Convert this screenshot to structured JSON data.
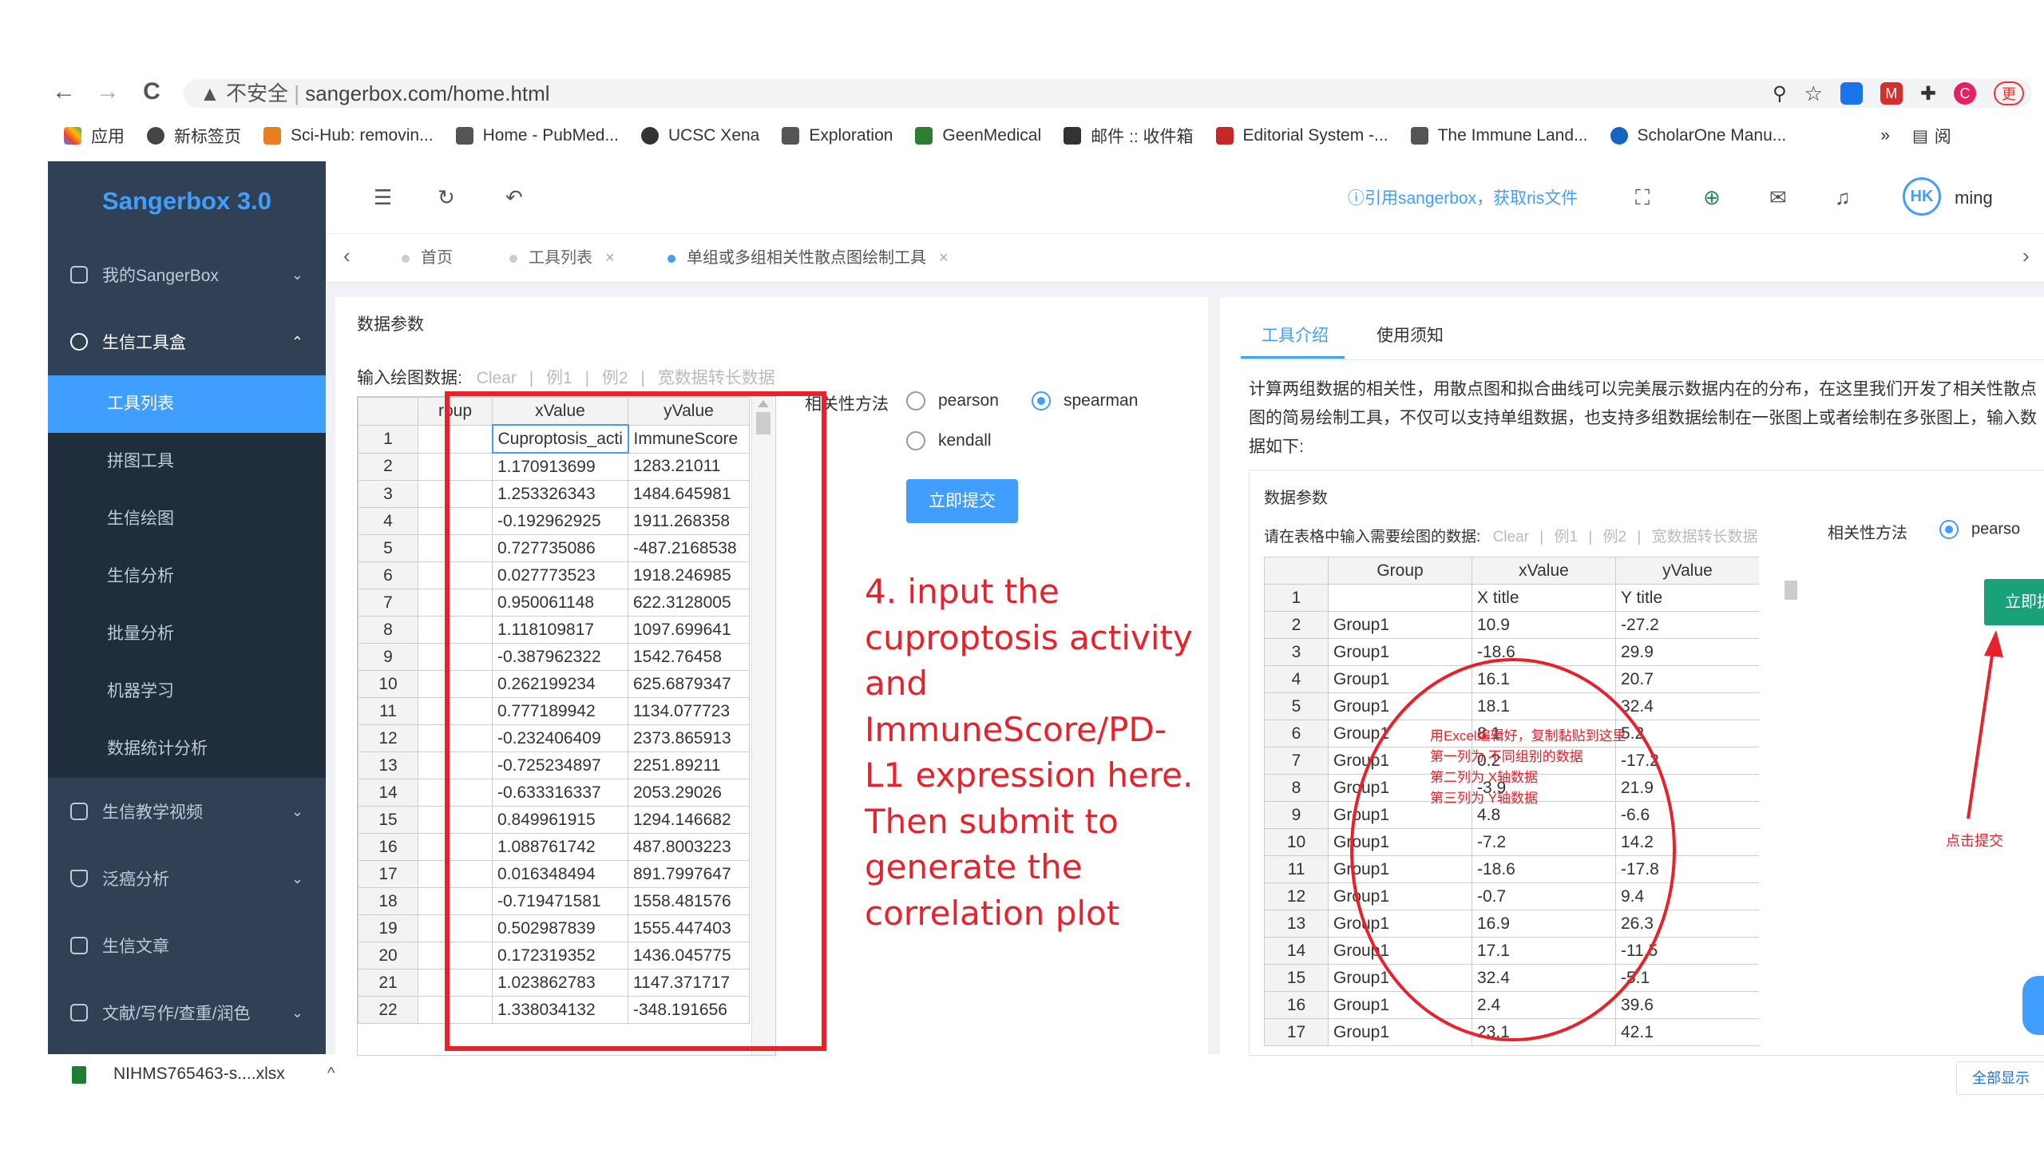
{
  "browser": {
    "nav": [
      "←",
      "→",
      "C"
    ],
    "security": "不安全",
    "url": "sangerbox.com/home.html",
    "bookmarks": [
      "应用",
      "新标签页",
      "Sci-Hub: removin...",
      "Home - PubMed...",
      "UCSC Xena",
      "Exploration",
      "GeenMedical",
      "邮件 :: 收件箱",
      "Editorial System -...",
      "The Immune Land...",
      "ScholarOne Manu..."
    ],
    "bookmarks_more": "»",
    "reading": "阅",
    "profile_label": "更"
  },
  "sidebar": {
    "logo": "Sangerbox 3.0",
    "menus": [
      {
        "label": "我的SangerBox",
        "arrow": "⌄"
      },
      {
        "label": "生信工具盒",
        "arrow": "⌃"
      }
    ],
    "submenu": [
      "工具列表",
      "拼图工具",
      "生信绘图",
      "生信分析",
      "批量分析",
      "机器学习",
      "数据统计分析"
    ],
    "menus2": [
      "生信教学视频",
      "泛癌分析",
      "生信文章",
      "文献/写作/查重/润色"
    ]
  },
  "header": {
    "cite": "ⓘ引用sangerbox，获取ris文件",
    "user": "ming"
  },
  "tags": [
    "首页",
    "工具列表",
    "单组或多组相关性散点图绘制工具"
  ],
  "left_panel": {
    "title": "数据参数",
    "input_label": "输入绘图数据:",
    "links": [
      "Clear",
      "例1",
      "例2",
      "宽数据转长数据"
    ],
    "separator": "|",
    "columns": [
      "roup",
      "xValue",
      "yValue"
    ],
    "rows": [
      [
        "1",
        "",
        "Cuproptosis_acti",
        "ImmuneScore"
      ],
      [
        "2",
        "",
        "1.170913699",
        "1283.21011"
      ],
      [
        "3",
        "",
        "1.253326343",
        "1484.645981"
      ],
      [
        "4",
        "",
        "-0.192962925",
        "1911.268358"
      ],
      [
        "5",
        "",
        "0.727735086",
        "-487.2168538"
      ],
      [
        "6",
        "",
        "0.027773523",
        "1918.246985"
      ],
      [
        "7",
        "",
        "0.950061148",
        "622.3128005"
      ],
      [
        "8",
        "",
        "1.118109817",
        "1097.699641"
      ],
      [
        "9",
        "",
        "-0.387962322",
        "1542.76458"
      ],
      [
        "10",
        "",
        "0.262199234",
        "625.6879347"
      ],
      [
        "11",
        "",
        "0.777189942",
        "1134.077723"
      ],
      [
        "12",
        "",
        "-0.232406409",
        "2373.865913"
      ],
      [
        "13",
        "",
        "-0.725234897",
        "2251.89211"
      ],
      [
        "14",
        "",
        "-0.633316337",
        "2053.29026"
      ],
      [
        "15",
        "",
        "0.849961915",
        "1294.146682"
      ],
      [
        "16",
        "",
        "1.088761742",
        "487.8003223"
      ],
      [
        "17",
        "",
        "0.016348494",
        "891.7997647"
      ],
      [
        "18",
        "",
        "-0.719471581",
        "1558.481576"
      ],
      [
        "19",
        "",
        "0.502987839",
        "1555.447403"
      ],
      [
        "20",
        "",
        "0.172319352",
        "1436.045775"
      ],
      [
        "21",
        "",
        "1.023862783",
        "1147.371717"
      ],
      [
        "22",
        "",
        "1.338034132",
        "-348.191656"
      ]
    ],
    "method_label": "相关性方法",
    "methods": [
      "pearson",
      "spearman",
      "kendall"
    ],
    "selected_method": "spearman",
    "submit": "立即提交",
    "note": [
      "4. input the",
      "cuproptosis activity",
      "and",
      "ImmuneScore/PD-",
      "L1 expression here.",
      "Then submit to",
      "generate the",
      "correlation plot"
    ]
  },
  "right_panel": {
    "tabs": [
      "工具介绍",
      "使用须知"
    ],
    "desc1": "计算两组数据的相关性，用散点图和拟合曲线可以完美展示数据内在的分布，在这里我们开发了相关性散点",
    "desc2": "图的简易绘制工具，不仅可以支持单组数据，也支持多组数据绘制在一张图上或者绘制在多张图上，输入数",
    "desc3": "据如下:",
    "sub_title": "数据参数",
    "input_label": "请在表格中输入需要绘图的数据:",
    "links": [
      "Clear",
      "例1",
      "例2",
      "宽数据转长数据"
    ],
    "columns": [
      "Group",
      "xValue",
      "yValue"
    ],
    "rows": [
      [
        "1",
        "",
        "X title",
        "Y title"
      ],
      [
        "2",
        "Group1",
        "10.9",
        "-27.2"
      ],
      [
        "3",
        "Group1",
        "-18.6",
        "29.9"
      ],
      [
        "4",
        "Group1",
        "16.1",
        "20.7"
      ],
      [
        "5",
        "Group1",
        "18.1",
        "32.4"
      ],
      [
        "6",
        "Group1",
        "8.1",
        "5.2"
      ],
      [
        "7",
        "Group1",
        "0.2",
        "-17.2"
      ],
      [
        "8",
        "Group1",
        "-3.9",
        "21.9"
      ],
      [
        "9",
        "Group1",
        "4.8",
        "-6.6"
      ],
      [
        "10",
        "Group1",
        "-7.2",
        "14.2"
      ],
      [
        "11",
        "Group1",
        "-18.6",
        "-17.8"
      ],
      [
        "12",
        "Group1",
        "-0.7",
        "9.4"
      ],
      [
        "13",
        "Group1",
        "16.9",
        "26.3"
      ],
      [
        "14",
        "Group1",
        "17.1",
        "-11.5"
      ],
      [
        "15",
        "Group1",
        "32.4",
        "-5.1"
      ],
      [
        "16",
        "Group1",
        "2.4",
        "39.6"
      ],
      [
        "17",
        "Group1",
        "23.1",
        "42.1"
      ]
    ],
    "method_label": "相关性方法",
    "method": "pearso",
    "submit": "立即提交",
    "annot": [
      "用Excel编辑好，复制黏贴到这里",
      "第一列为 不同组别的数据",
      "第二列为 X轴数据",
      "第三列为 Y轴数据"
    ],
    "click_note": "点击提交"
  },
  "downloads": {
    "file": "NIHMS765463-s....xlsx",
    "show_all": "全部显示"
  }
}
